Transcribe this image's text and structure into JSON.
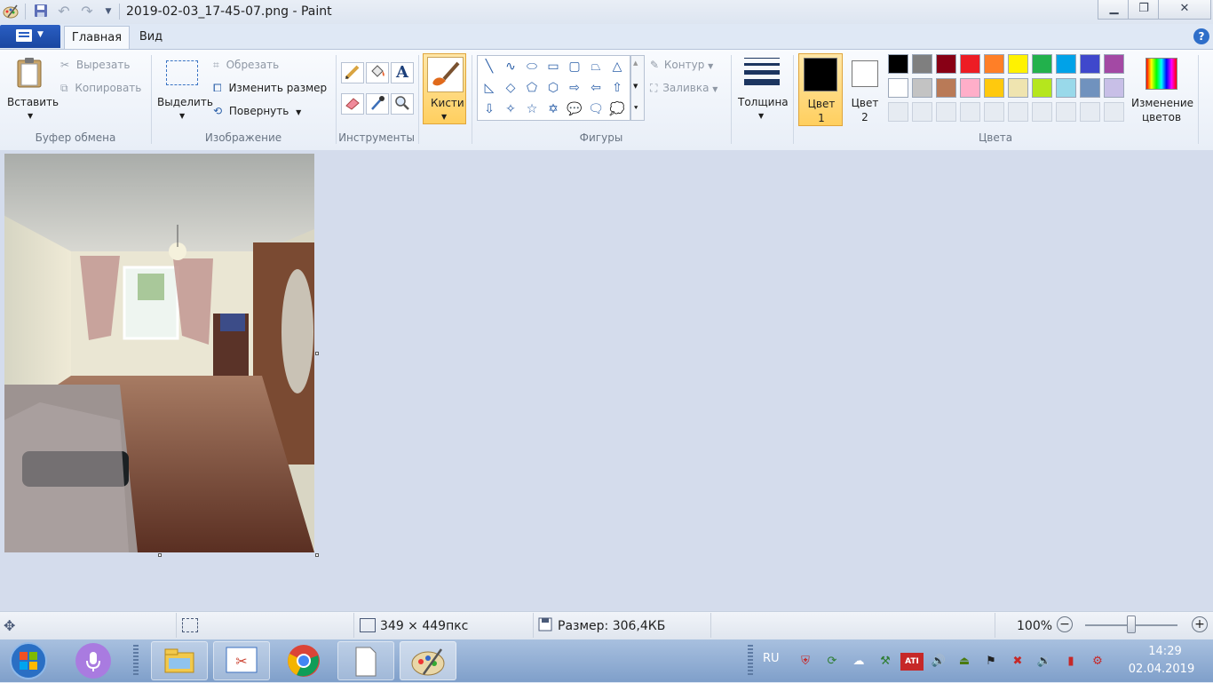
{
  "window": {
    "title": "2019-02-03_17-45-07.png - Paint",
    "qat_icons": [
      "paint-app-icon",
      "save-icon",
      "undo-icon",
      "redo-icon",
      "customize-dropdown-icon"
    ],
    "controls": {
      "minimize": "▁",
      "maximize": "❐",
      "close": "✕"
    }
  },
  "tabs": {
    "file_icon": "☰▾",
    "home": "Главная",
    "view": "Вид",
    "help": "?"
  },
  "ribbon": {
    "clipboard": {
      "paste": "Вставить",
      "cut": "Вырезать",
      "copy": "Копировать",
      "group": "Буфер обмена"
    },
    "image": {
      "select": "Выделить",
      "crop": "Обрезать",
      "resize": "Изменить размер",
      "rotate": "Повернуть",
      "group": "Изображение"
    },
    "tools": {
      "group": "Инструменты",
      "items": [
        "pencil-icon",
        "fill-icon",
        "text-icon",
        "eraser-icon",
        "color-picker-icon",
        "magnifier-icon"
      ]
    },
    "brushes": {
      "label": "Кисти"
    },
    "shapes": {
      "outline": "Контур",
      "fill": "Заливка",
      "group": "Фигуры",
      "items": [
        "╲",
        "∿",
        "⬭",
        "▭",
        "▢",
        "⏢",
        "△",
        "◺",
        "◇",
        "⬠",
        "⬡",
        "⇨",
        "⇦",
        "⇧",
        "⇩",
        "✧",
        "☆",
        "✡",
        "💬",
        "🗨",
        "💭"
      ]
    },
    "thickness": {
      "label": "Толщина"
    },
    "colors": {
      "color1_label": "Цвет 1",
      "color2_label": "Цвет 2",
      "color1_value": "#000000",
      "color2_value": "#ffffff",
      "edit_label": "Изменение цветов",
      "group": "Цвета",
      "palette_row1": [
        "#000000",
        "#7f7f7f",
        "#880015",
        "#ed1c24",
        "#ff7f27",
        "#fff200",
        "#22b14c",
        "#00a2e8",
        "#3f48cc",
        "#a349a4"
      ],
      "palette_row2": [
        "#ffffff",
        "#c3c3c3",
        "#b97a57",
        "#ffaec9",
        "#ffc90e",
        "#efe4b0",
        "#b5e61d",
        "#99d9ea",
        "#7092be",
        "#c8bfe7"
      ],
      "palette_row3": [
        "",
        "",
        "",
        "",
        "",
        "",
        "",
        "",
        "",
        ""
      ]
    }
  },
  "canvas": {
    "image_label": "room-photo"
  },
  "status": {
    "dimensions": "349 × 449пкс",
    "size": "Размер: 306,4КБ",
    "zoom": "100%",
    "zoom_minus": "−",
    "zoom_plus": "+",
    "zoom_level": 0.5
  },
  "taskbar": {
    "lang": "RU",
    "time": "14:29",
    "date": "02.04.2019"
  }
}
